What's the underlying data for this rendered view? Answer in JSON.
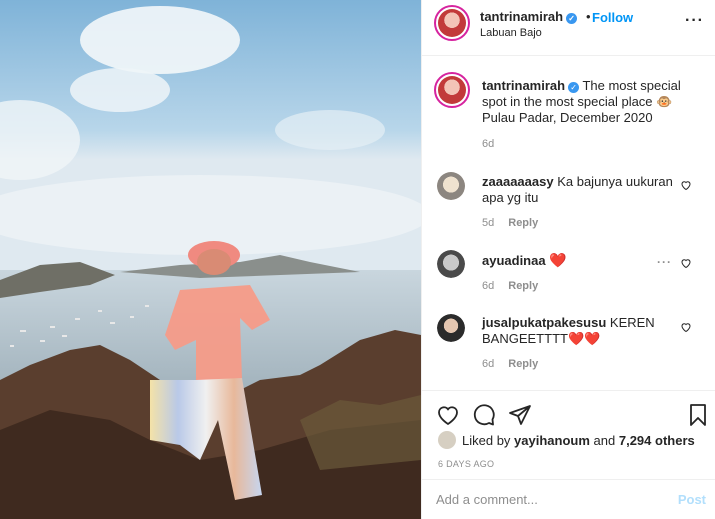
{
  "post": {
    "username": "tantrinamirah",
    "follow_label": "Follow",
    "dot": "•",
    "location": "Labuan Bajo",
    "more_icon": "more-horizontal-icon"
  },
  "caption": {
    "username": "tantrinamirah",
    "text": "The most special spot in the most special place 🐵 Pulau Padar, December 2020",
    "time": "6d"
  },
  "comments": [
    {
      "username": "zaaaaaaasy",
      "text": "Ka bajunya uukuran apa yg itu",
      "time": "5d",
      "reply": "Reply"
    },
    {
      "username": "ayuadinaa",
      "text": "❤️",
      "time": "6d",
      "reply": "Reply"
    },
    {
      "username": "jusalpukatpakesusu",
      "text": "KEREN BANGEETTTT❤️❤️",
      "time": "6d",
      "reply": "Reply"
    }
  ],
  "likes": {
    "prefix": "Liked by",
    "user": "yayihanoum",
    "middle": "and",
    "count": "7,294 others"
  },
  "date": "6 DAYS AGO",
  "add_comment": {
    "placeholder": "Add a comment...",
    "post_label": "Post"
  },
  "colors": {
    "accent": "#0095f6",
    "verified": "#3897f0",
    "heart": "#ed4956",
    "muted": "#8e8e8e"
  }
}
